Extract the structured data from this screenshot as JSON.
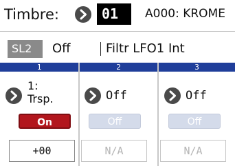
{
  "header": {
    "timbre_label": "Timbre:",
    "timbre_value": "01",
    "program_name": "A000: KROME"
  },
  "param": {
    "badge": "SL2",
    "value": "Off",
    "name": "Filtr LFO1 Int"
  },
  "columns": [
    {
      "number": "1",
      "dest_line1": "1:",
      "dest_line2": "Trsp.",
      "switch": "On",
      "amount": "+00",
      "active": true
    },
    {
      "number": "2",
      "dest": "Off",
      "switch": "Off",
      "amount": "N/A",
      "active": false
    },
    {
      "number": "3",
      "dest": "Off",
      "switch": "Off",
      "amount": "N/A",
      "active": false
    }
  ],
  "colors": {
    "column_header": "#1f3e9a",
    "on_button": "#b2161d",
    "off_button": "#d4dbea",
    "badge": "#8a8a8a"
  },
  "icons": {
    "arrow": "chevron-right-circle-icon"
  }
}
